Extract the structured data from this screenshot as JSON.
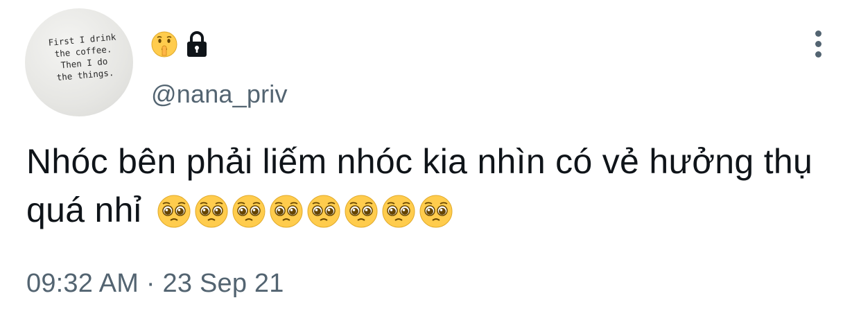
{
  "avatar": {
    "text": "First I drink\nthe coffee.\nThen I do\nthe things."
  },
  "user": {
    "name_icons": [
      "shushing-face-icon",
      "lock-icon"
    ],
    "handle": "@nana_priv"
  },
  "tweet": {
    "text": "Nhóc bên phải liếm nhóc kia nhìn có vẻ hưởng thụ quá nhỉ",
    "emojis": [
      "pleading-face-icon",
      "pleading-face-icon",
      "pleading-face-icon",
      "pleading-face-icon",
      "pleading-face-icon",
      "pleading-face-icon",
      "pleading-face-icon",
      "pleading-face-icon"
    ],
    "timestamp": "09:32 AM · 23 Sep 21"
  },
  "colors": {
    "text_primary": "#0f1419",
    "text_secondary": "#536471",
    "emoji_yellow": "#ffcc4d"
  }
}
